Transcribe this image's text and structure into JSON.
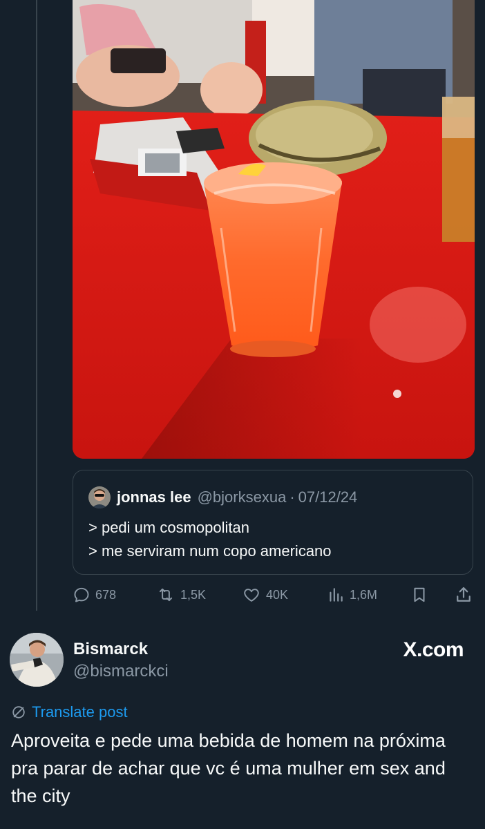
{
  "quoted_tweet": {
    "name": "jonnas lee",
    "handle": "@bjorksexua",
    "separator": "·",
    "date": "07/12/24",
    "lines": [
      "> pedi um cosmopolitan",
      "> me serviram num copo americano"
    ]
  },
  "actions": {
    "replies": "678",
    "retweets": "1,5K",
    "likes": "40K",
    "views": "1,6M"
  },
  "tweet": {
    "author_name": "Bismarck",
    "author_handle": "@bismarckci",
    "brand": "X.com",
    "translate_label": "Translate post",
    "text": "Aproveita e pede uma bebida de homem na próxima pra parar de achar que vc é uma mulher em sex and the city"
  },
  "colors": {
    "background": "#15202b",
    "text_primary": "#f7f9f9",
    "text_secondary": "#8b98a5",
    "link": "#1d9bf0",
    "border": "#38444d"
  },
  "icons": [
    "reply-icon",
    "retweet-icon",
    "like-icon",
    "views-icon",
    "bookmark-icon",
    "share-icon",
    "translate-icon"
  ]
}
